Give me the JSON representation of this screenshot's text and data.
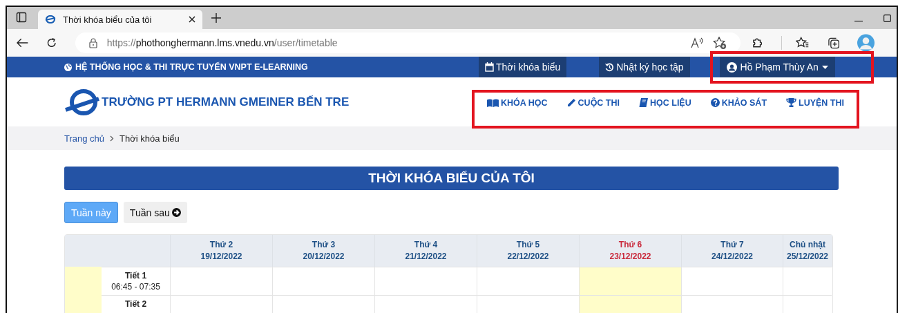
{
  "browser": {
    "tab_title": "Thời khóa biểu của tôi",
    "url": {
      "scheme": "https://",
      "host": "phothonghermann.lms.vnedu.vn",
      "path": "/user/timetable"
    }
  },
  "topbar": {
    "brand": "HỆ THỐNG HỌC & THI TRỰC TUYẾN VNPT E-LEARNING",
    "links": [
      {
        "label": "Thời khóa biểu"
      },
      {
        "label": "Nhật ký học tập"
      }
    ],
    "user_menu": {
      "name": "Hồ Phạm Thùy An",
      "highlighted": true
    }
  },
  "header": {
    "school_name": "TRƯỜNG PT HERMANN GMEINER BẾN TRE",
    "nav_highlighted": true,
    "nav": [
      {
        "label": "KHÓA HỌC"
      },
      {
        "label": "CUỘC THI"
      },
      {
        "label": "HỌC LIỆU"
      },
      {
        "label": "KHẢO SÁT"
      },
      {
        "label": "LUYỆN THI"
      }
    ]
  },
  "breadcrumb": [
    "Trang chủ",
    "Thời khóa biểu"
  ],
  "title": "THỜI KHÓA BIỂU CỦA TÔI",
  "week_buttons": [
    {
      "label": "Tuần này",
      "selected": true
    },
    {
      "label": "Tuần sau",
      "selected": false
    }
  ],
  "timetable": {
    "columns": [
      {
        "day": "Thứ 2",
        "date": "19/12/2022",
        "selected": false
      },
      {
        "day": "Thứ 3",
        "date": "20/12/2022",
        "selected": false
      },
      {
        "day": "Thứ 4",
        "date": "21/12/2022",
        "selected": false
      },
      {
        "day": "Thứ 5",
        "date": "22/12/2022",
        "selected": false
      },
      {
        "day": "Thứ 6",
        "date": "23/12/2022",
        "selected": true
      },
      {
        "day": "Thứ 7",
        "date": "24/12/2022",
        "selected": false
      },
      {
        "day": "Chủ nhật",
        "date": "25/12/2022",
        "selected": false
      }
    ],
    "rows": [
      {
        "period": "Tiết 1",
        "time": "06:45 - 07:35"
      },
      {
        "period": "Tiết 2"
      }
    ]
  }
}
